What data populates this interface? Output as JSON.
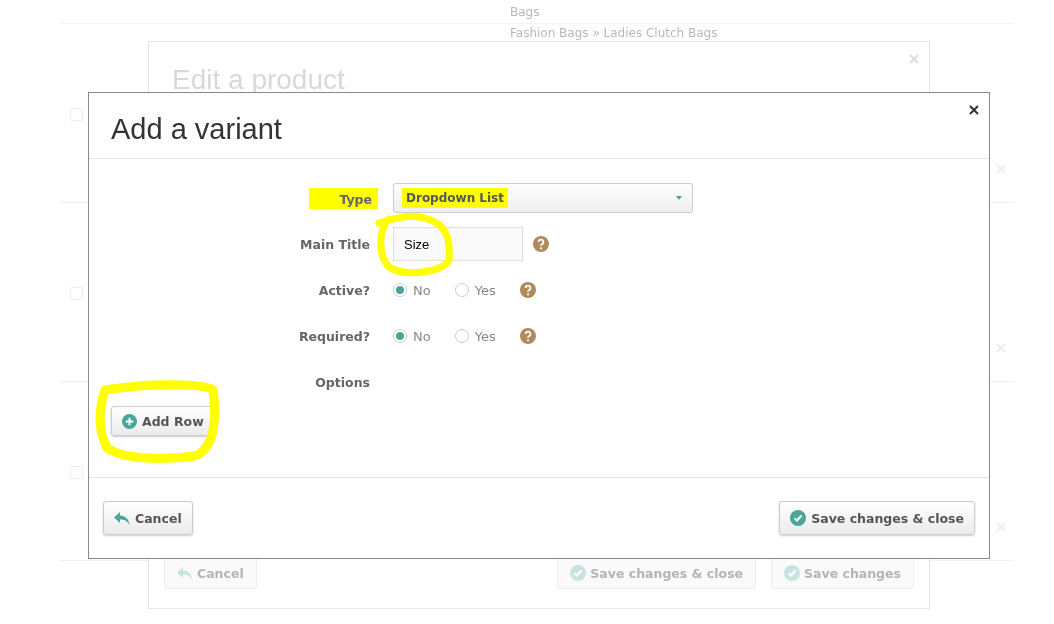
{
  "background": {
    "texts": [
      "Bags",
      "Fashion Bags » Ladies Clutch Bags"
    ],
    "rows": [
      {
        "checked": false
      },
      {
        "checked": false
      },
      {
        "checked": false
      }
    ]
  },
  "edit_modal": {
    "title": "Edit a product",
    "buttons": [
      {
        "label": "Cancel",
        "kind": "back"
      },
      {
        "label": "Save changes & close",
        "kind": "check"
      },
      {
        "label": "Save changes",
        "kind": "check"
      }
    ]
  },
  "variant_modal": {
    "title": "Add a variant",
    "fields": [
      {
        "kind": "select",
        "label": "Type",
        "value": "Dropdown List",
        "highlighted": true
      },
      {
        "kind": "text",
        "label": "Main Title",
        "value": "Size",
        "help": true,
        "circled": true
      },
      {
        "kind": "radio",
        "label": "Active?",
        "help": true,
        "options": [
          {
            "label": "No",
            "selected": true
          },
          {
            "label": "Yes",
            "selected": false
          }
        ]
      },
      {
        "kind": "radio",
        "label": "Required?",
        "help": true,
        "options": [
          {
            "label": "No",
            "selected": true
          },
          {
            "label": "Yes",
            "selected": false
          }
        ]
      },
      {
        "kind": "heading",
        "label": "Options"
      }
    ],
    "add_row": {
      "label": "Add Row",
      "circled": true
    },
    "buttons": [
      {
        "label": "Cancel",
        "kind": "back"
      },
      {
        "label": "Save changes & close",
        "kind": "check"
      }
    ]
  }
}
